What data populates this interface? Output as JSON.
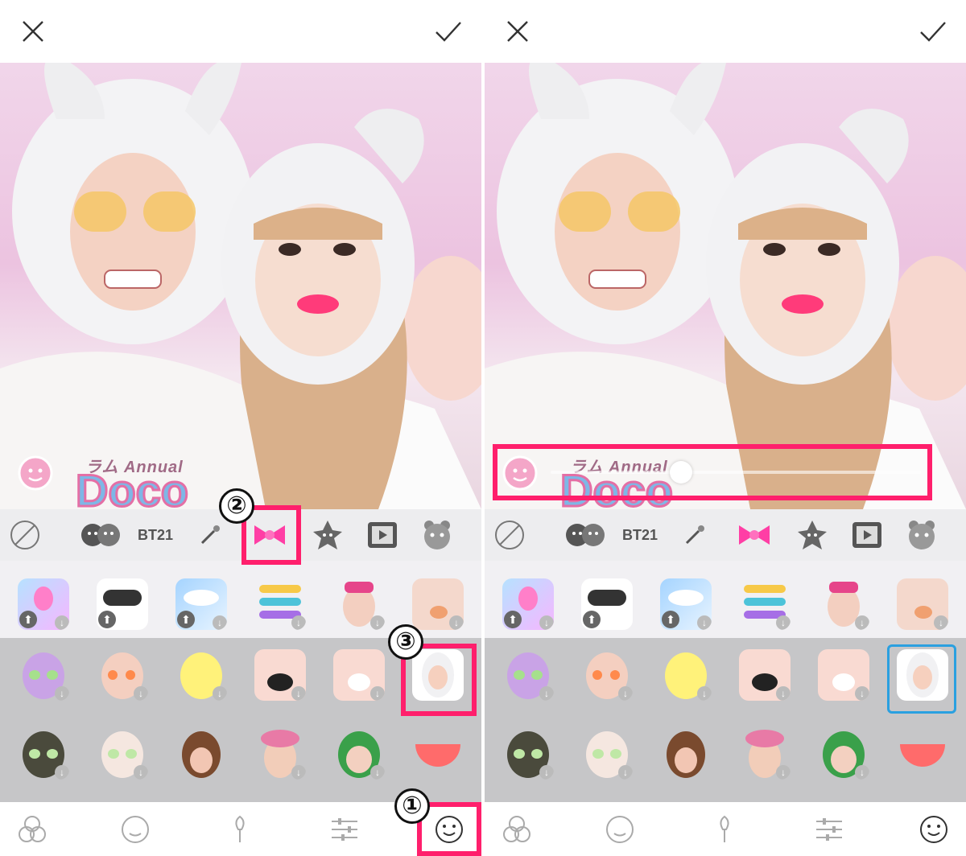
{
  "topbar": {
    "close_icon": "close-icon",
    "confirm_icon": "check-icon"
  },
  "photo": {
    "frame_caption": "ラム Annual",
    "frame_big": "Doco"
  },
  "categories": [
    {
      "name": "none",
      "icon": "no-filter-icon"
    },
    {
      "name": "faces",
      "icon": "twin-faces-icon"
    },
    {
      "name": "bt21",
      "label": "BT21"
    },
    {
      "name": "brush",
      "icon": "brush-icon"
    },
    {
      "name": "bow",
      "icon": "bow-icon"
    },
    {
      "name": "star-face",
      "icon": "star-face-icon"
    },
    {
      "name": "video",
      "icon": "video-icon"
    },
    {
      "name": "animal",
      "icon": "animal-face-icon"
    }
  ],
  "annotations": {
    "badge1": "①",
    "badge2": "②",
    "badge3": "③"
  },
  "bottom_nav": [
    {
      "name": "filter",
      "icon": "circles-icon"
    },
    {
      "name": "face",
      "icon": "face-retouch-icon"
    },
    {
      "name": "makeup",
      "icon": "makeup-brush-icon"
    },
    {
      "name": "adjust",
      "icon": "sliders-icon"
    },
    {
      "name": "sticker",
      "icon": "smiley-icon"
    }
  ],
  "colors": {
    "highlight": "#ff1f6c",
    "selected": "#2aa0e0",
    "bow": "#ff3ea5"
  }
}
